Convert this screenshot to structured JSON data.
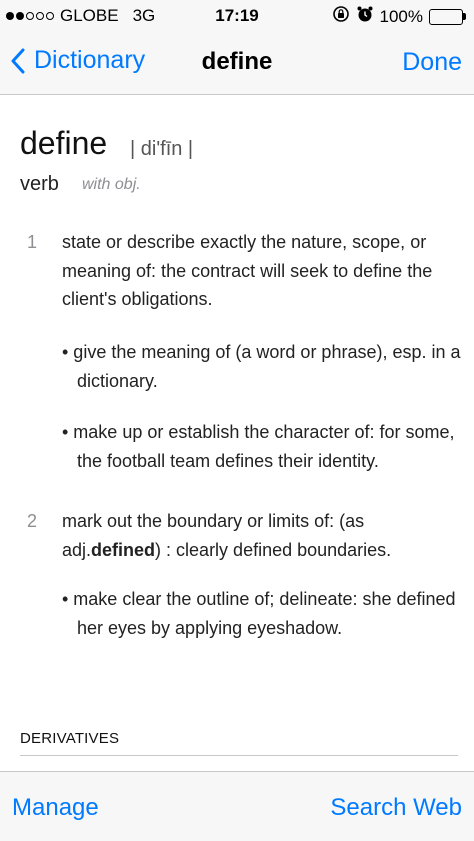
{
  "status_bar": {
    "carrier": "GLOBE",
    "network": "3G",
    "time": "17:19",
    "battery_percent": "100%",
    "battery_level": 1.0,
    "battery_color": "#4cd964"
  },
  "nav": {
    "back_label": "Dictionary",
    "title": "define",
    "done_label": "Done"
  },
  "entry": {
    "headword": "define",
    "pronunciation": "| di'fīn |",
    "part_of_speech": "verb",
    "grammar_note": "with obj.",
    "senses": [
      {
        "number": "1",
        "definition": "state or describe exactly the nature, scope, or meaning of: the contract will seek to define the client's obligations.",
        "subsenses": [
          "• give the meaning of (a word or phrase), esp. in a dictionary.",
          "• make up or establish the character of: for some, the football team defines their identity."
        ]
      },
      {
        "number": "2",
        "definition_part1": "mark out the boundary or limits of: (as adj.",
        "definition_bold": "defined",
        "definition_part2": ") : clearly defined boundaries.",
        "subsenses": [
          "• make clear the outline of; delineate: she defined her eyes by applying eyeshadow."
        ]
      }
    ],
    "derivatives_header": "DERIVATIVES"
  },
  "toolbar": {
    "manage_label": "Manage",
    "search_web_label": "Search Web"
  },
  "colors": {
    "accent": "#007aff",
    "bar_background": "#f7f7f7",
    "separator": "#c8c7cc"
  }
}
